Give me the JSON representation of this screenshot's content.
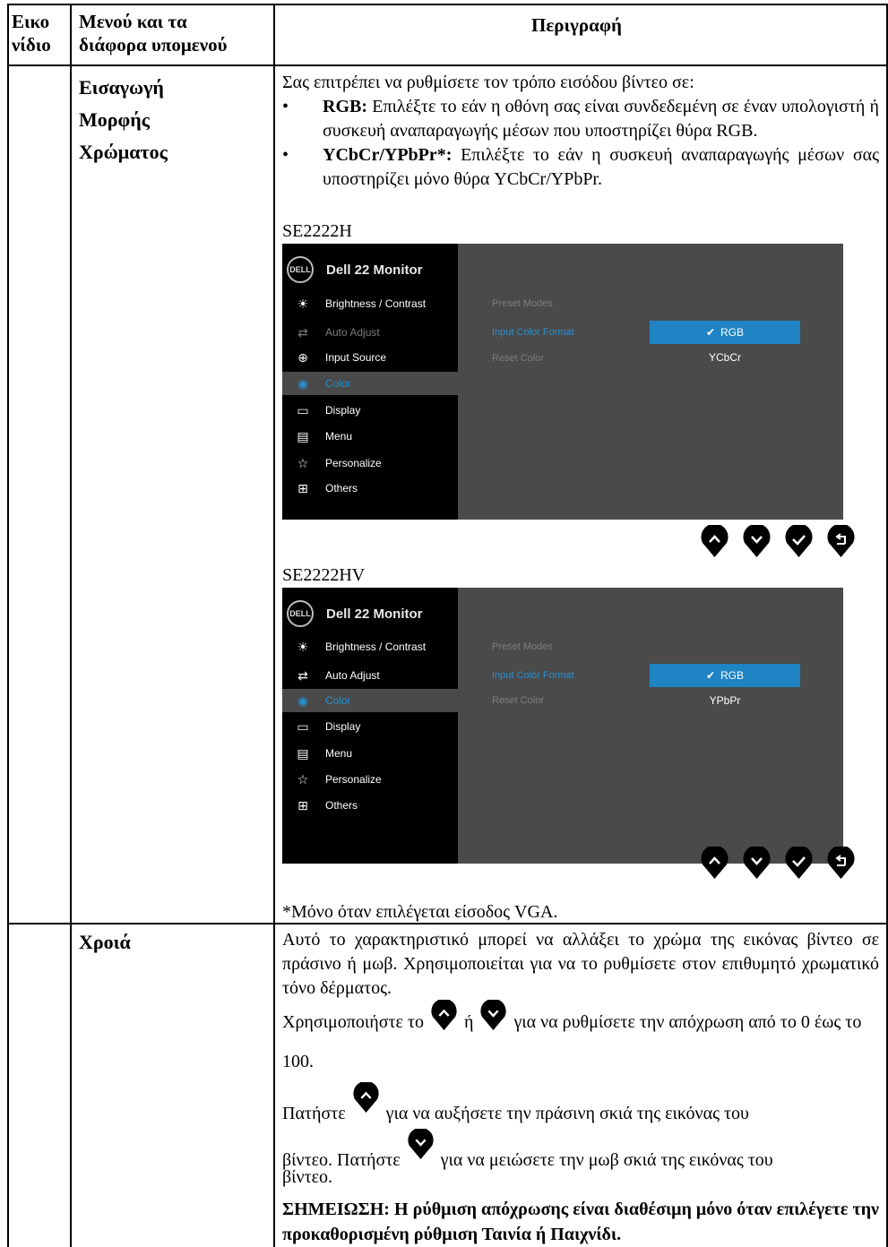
{
  "header": {
    "col1": [
      "Εικο",
      "νίδιο"
    ],
    "col2": [
      "Μενού και τα",
      "διάφορα υπομενού"
    ],
    "col3": "Περιγραφή"
  },
  "row1": {
    "menu": [
      "Εισαγωγή",
      "Μορφής",
      "Χρώματος"
    ],
    "intro": "Σας επιτρέπει να ρυθμίσετε τον τρόπο εισόδου βίντεο σε:",
    "bullet1_bold": "RGB:",
    "bullet1_text": " Επιλέξτε το εάν η οθόνη σας είναι συνδεδεμένη σε έναν υπολογιστή ή συσκευή αναπαραγωγής μέσων που υποστηρίζει θύρα RGB.",
    "bullet2_bold": "YCbCr/YPbPr*:",
    "bullet2_text": " Επιλέξτε το εάν η συσκευή αναπαραγωγής μέσων σας υποστηρίζει μόνο θύρα YCbCr/YPbPr.",
    "bullet_mark": "•",
    "model1": "SE2222H",
    "model2": "SE2222HV",
    "footnote": "*Μόνο όταν επιλέγεται είσοδος VGA."
  },
  "osd1": {
    "logo": "DELL",
    "title": "Dell 22 Monitor",
    "menu": [
      "Brightness / Contrast",
      "Auto Adjust",
      "Input Source",
      "Color",
      "Display",
      "Menu",
      "Personalize",
      "Others"
    ],
    "sub": [
      "Preset Modes",
      "Input Color Format",
      "Reset Color"
    ],
    "opt_selected": "RGB",
    "opt_other": "YCbCr",
    "check": "✔"
  },
  "osd2": {
    "logo": "DELL",
    "title": "Dell 22 Monitor",
    "menu": [
      "Brightness / Contrast",
      "Auto Adjust",
      "Color",
      "Display",
      "Menu",
      "Personalize",
      "Others"
    ],
    "sub": [
      "Preset Modes",
      "Input Color Format",
      "Reset Color"
    ],
    "opt_selected": "RGB",
    "opt_other": "YPbPr",
    "check": "✔"
  },
  "row2": {
    "menu": "Χροιά",
    "p1": "Αυτό το χαρακτηριστικό μπορεί να αλλάξει το χρώμα της εικόνας βίντεο σε πράσινο ή μωβ. Χρησιμοποιείται για να το ρυθμίσετε στον επιθυμητό χρωματικό τόνο δέρματος.",
    "p2a": "Χρησιμοποιήστε το",
    "p2b": " ή ",
    "p2c": "για να ρυθμίσετε την απόχρωση από το 0 έως το 100.",
    "p3a": "Πατήστε",
    "p3b": "για να αυξήσετε την πράσινη σκιά της εικόνας του",
    "p4a": "βίντεο. Πατήστε",
    "p4b": "για να μειώσετε την μωβ σκιά της εικόνας του",
    "p5": "βίντεο.",
    "note": "ΣΗΜΕΙΩΣΗ: Η ρύθμιση απόχρωσης είναι διαθέσιμη μόνο όταν επιλέγετε την προκαθορισμένη ρύθμιση Ταινία ή Παιχνίδι."
  }
}
